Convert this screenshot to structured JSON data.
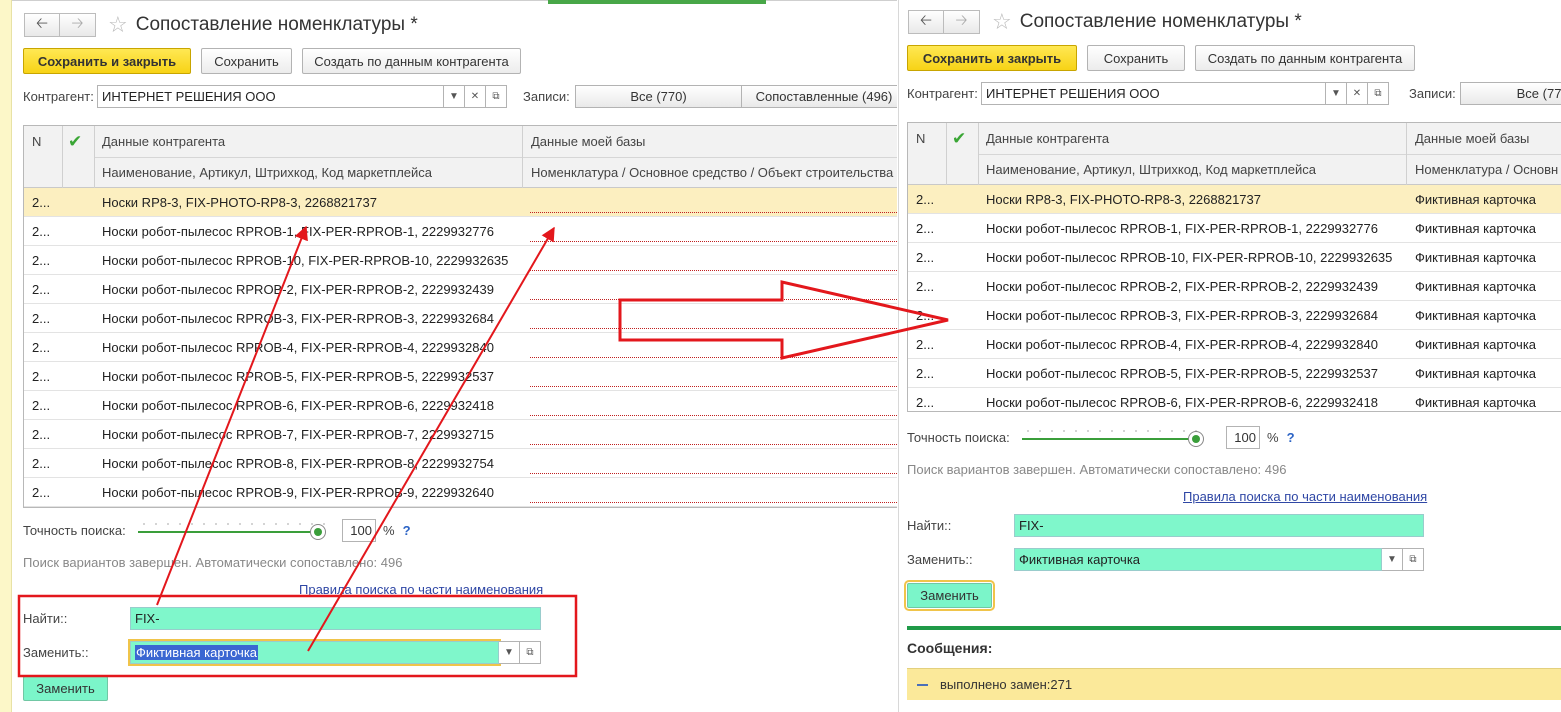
{
  "window_title": "Сопоставление номенклатуры *",
  "toolbar": {
    "save_close": "Сохранить и закрыть",
    "save": "Сохранить",
    "create_by_contractor": "Создать по данным контрагента"
  },
  "contractor": {
    "label": "Контрагент:",
    "value": "ИНТЕРНЕТ РЕШЕНИЯ ООО"
  },
  "records": {
    "label": "Записи:",
    "all": "Все (770)",
    "matched": "Сопоставленные (496)"
  },
  "columns": {
    "n": "N",
    "contractor_data": "Данные контрагента",
    "contractor_sub": "Наименование, Артикул, Штрихкод, Код маркетплейса",
    "my_data": "Данные моей базы",
    "my_sub_full": "Номенклатура / Основное средство / Объект строительства",
    "my_sub_short": "Номенклатура / Основн"
  },
  "rows_left": [
    {
      "n": "2...",
      "name": "Носки RP8-3, FIX-PHOTO-RP8-3, 2268821737",
      "mine": ""
    },
    {
      "n": "2...",
      "name": "Носки робот-пылесос RPROB-1, FIX-PER-RPROB-1, 2229932776",
      "mine": ""
    },
    {
      "n": "2...",
      "name": "Носки робот-пылесос RPROB-10, FIX-PER-RPROB-10, 2229932635",
      "mine": ""
    },
    {
      "n": "2...",
      "name": "Носки робот-пылесос RPROB-2, FIX-PER-RPROB-2, 2229932439",
      "mine": ""
    },
    {
      "n": "2...",
      "name": "Носки робот-пылесос RPROB-3, FIX-PER-RPROB-3, 2229932684",
      "mine": ""
    },
    {
      "n": "2...",
      "name": "Носки робот-пылесос RPROB-4, FIX-PER-RPROB-4, 2229932840",
      "mine": ""
    },
    {
      "n": "2...",
      "name": "Носки робот-пылесос RPROB-5, FIX-PER-RPROB-5, 2229932537",
      "mine": ""
    },
    {
      "n": "2...",
      "name": "Носки робот-пылесос RPROB-6, FIX-PER-RPROB-6, 2229932418",
      "mine": ""
    },
    {
      "n": "2...",
      "name": "Носки робот-пылесос RPROB-7, FIX-PER-RPROB-7, 2229932715",
      "mine": ""
    },
    {
      "n": "2...",
      "name": "Носки робот-пылесос RPROB-8, FIX-PER-RPROB-8, 2229932754",
      "mine": ""
    },
    {
      "n": "2...",
      "name": "Носки робот-пылесос RPROB-9, FIX-PER-RPROB-9, 2229932640",
      "mine": ""
    }
  ],
  "rows_right": [
    {
      "n": "2...",
      "name": "Носки RP8-3, FIX-PHOTO-RP8-3, 2268821737",
      "mine": "Фиктивная карточка"
    },
    {
      "n": "2...",
      "name": "Носки робот-пылесос RPROB-1, FIX-PER-RPROB-1, 2229932776",
      "mine": "Фиктивная карточка"
    },
    {
      "n": "2...",
      "name": "Носки робот-пылесос RPROB-10, FIX-PER-RPROB-10, 2229932635",
      "mine": "Фиктивная карточка"
    },
    {
      "n": "2...",
      "name": "Носки робот-пылесос RPROB-2, FIX-PER-RPROB-2, 2229932439",
      "mine": "Фиктивная карточка"
    },
    {
      "n": "2...",
      "name": "Носки робот-пылесос RPROB-3, FIX-PER-RPROB-3, 2229932684",
      "mine": "Фиктивная карточка"
    },
    {
      "n": "2...",
      "name": "Носки робот-пылесос RPROB-4, FIX-PER-RPROB-4, 2229932840",
      "mine": "Фиктивная карточка"
    },
    {
      "n": "2...",
      "name": "Носки робот-пылесос RPROB-5, FIX-PER-RPROB-5, 2229932537",
      "mine": "Фиктивная карточка"
    },
    {
      "n": "2...",
      "name": "Носки робот-пылесос RPROB-6, FIX-PER-RPROB-6, 2229932418",
      "mine": "Фиктивная карточка"
    }
  ],
  "accuracy": {
    "label": "Точность поиска:",
    "value": "100",
    "unit": "%",
    "help": "?"
  },
  "status_text": "Поиск вариантов завершен. Автоматически сопоставлено: 496",
  "rules_link": "Правила поиска по части наименования",
  "find": {
    "label": "Найти::",
    "value": "FIX-"
  },
  "replace": {
    "label": "Заменить::",
    "value": "Фиктивная карточка"
  },
  "replace_button": "Заменить",
  "messages": {
    "title": "Сообщения:",
    "text": "выполнено замен:271"
  },
  "icons": {
    "back": "arrow-left-icon",
    "forward": "arrow-right-icon",
    "favorite": "star-icon",
    "dropdown": "chevron-down-icon",
    "clear": "close-icon",
    "open": "open-window-icon",
    "matched": "checkmark-icon",
    "message": "dash-icon"
  },
  "colors": {
    "primary_button": "#f7d316",
    "selected_row": "#fcefc0",
    "find_field": "#7ff7cb",
    "check": "#3aa635",
    "annotation": "#e3171c",
    "message_bg": "#fbe99a",
    "link": "#2f47a5"
  }
}
